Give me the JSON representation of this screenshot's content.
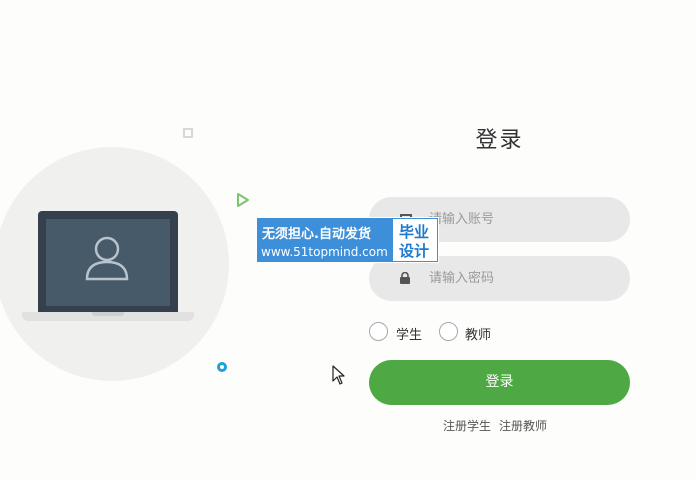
{
  "login": {
    "title": "登录",
    "account_placeholder": "请输入账号",
    "password_placeholder": "请输入密码",
    "roles": [
      "学生",
      "教师"
    ],
    "submit_label": "登录",
    "links": [
      "注册学生",
      "注册教师"
    ]
  },
  "watermark": {
    "line1": "无须担心.自动发货",
    "line2": "www.51topmind.com",
    "box_line1": "毕业",
    "box_line2": "设计"
  },
  "icons": {
    "illustration": "laptop-user-icon",
    "account_field": "user-card-icon",
    "password_field": "lock-icon",
    "decor": [
      "square-outline-icon",
      "triangle-play-icon",
      "ring-dot-icon"
    ]
  },
  "colors": {
    "primary_button": "#4ea843",
    "field_background": "#e8e8e8",
    "watermark_blue": "#3c8fd8",
    "accent_dot": "#1ea0d8",
    "triangle_green": "#7cc36e"
  }
}
